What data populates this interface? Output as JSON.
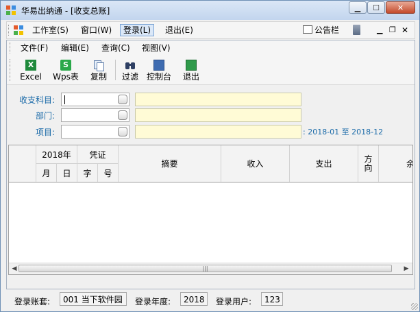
{
  "window": {
    "title": "华易出纳通 - [收支总账]"
  },
  "main_menu": {
    "items": [
      "工作室(S)",
      "窗口(W)",
      "登录(L)",
      "退出(E)"
    ],
    "notice_label": "公告栏"
  },
  "sub_menu": {
    "items": [
      "文件(F)",
      "编辑(E)",
      "查询(C)",
      "视图(V)"
    ]
  },
  "toolbar": {
    "buttons": [
      "Excel",
      "Wps表",
      "复制",
      "过滤",
      "控制台",
      "退出"
    ]
  },
  "filters": {
    "labels": [
      "收支科目:",
      "部门:",
      "项目:"
    ],
    "period_text": ": 2018-01 至 2018-12"
  },
  "grid": {
    "year_header": "2018年",
    "voucher_header": "凭证",
    "month": "月",
    "day": "日",
    "zi": "字",
    "hao": "号",
    "summary": "摘要",
    "income": "收入",
    "expense": "支出",
    "direction": "方\n向",
    "balance": "余"
  },
  "status": {
    "account_label": "登录账套:",
    "account_value": "001 当下软件园",
    "year_label": "登录年度:",
    "year_value": "2018",
    "user_label": "登录用户:",
    "user_value": "123"
  },
  "colors": {
    "label_blue": "#1a6aa8",
    "name_field_bg": "#fffbd6",
    "titlebar": "#c2d5ee"
  }
}
